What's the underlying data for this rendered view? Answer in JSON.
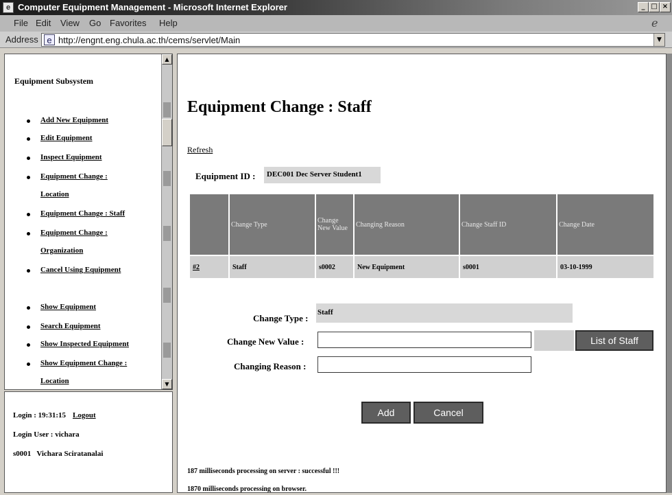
{
  "window": {
    "title": "Computer Equipment Management - Microsoft Internet Explorer"
  },
  "menu": [
    "File",
    "Edit",
    "View",
    "Go",
    "Favorites",
    "Help"
  ],
  "address": {
    "label": "Address",
    "url": "http://engnt.eng.chula.ac.th/cems/servlet/Main"
  },
  "sidebar": {
    "heading": "Equipment Subsystem",
    "items": [
      {
        "label": "Add New Equipment"
      },
      {
        "label": "Edit Equipment"
      },
      {
        "label": "Inspect Equipment"
      },
      {
        "label": "Equipment Change :"
      },
      {
        "label": "Location"
      },
      {
        "label": "Equipment Change : Staff"
      },
      {
        "label": "Equipment Change :"
      },
      {
        "label": "Organization"
      },
      {
        "label": "Cancel Using Equipment"
      },
      {
        "label": "Show Equipment"
      },
      {
        "label": "Search Equipment"
      },
      {
        "label": "Show Inspected Equipment"
      },
      {
        "label": "Show Equipment Change :"
      },
      {
        "label": "Location"
      }
    ]
  },
  "session": {
    "login_time": "Login : 19:31:15",
    "logout_label": "Logout",
    "login_user": "Login User : vichara",
    "staff_line": "s0001   Vichara Sciratanalai"
  },
  "main": {
    "title": "Equipment Change : Staff",
    "refresh_label": "Refresh",
    "equipment_id_label": "Equipment ID :",
    "equipment_id_value": "DEC001 Dec Server Student1",
    "table": {
      "headers": [
        "",
        "Change Type",
        "Change New Value",
        "Changing Reason",
        "Change Staff ID",
        "Change Date"
      ],
      "rows": [
        [
          "#2",
          "Staff",
          "s0002",
          "New Equipment",
          "s0001",
          "03-10-1999"
        ]
      ]
    },
    "form": {
      "change_type_label": "Change Type :",
      "change_type_value": "Staff",
      "new_value_label": "Change New Value :",
      "new_value": "",
      "reason_label": "Changing Reason :",
      "reason": "",
      "list_button": "List of Staff",
      "add_button": "Add",
      "cancel_button": "Cancel"
    },
    "status": {
      "server": "187 milliseconds processing on server : successful !!!",
      "browser": "1870 milliseconds processing on browser."
    }
  }
}
